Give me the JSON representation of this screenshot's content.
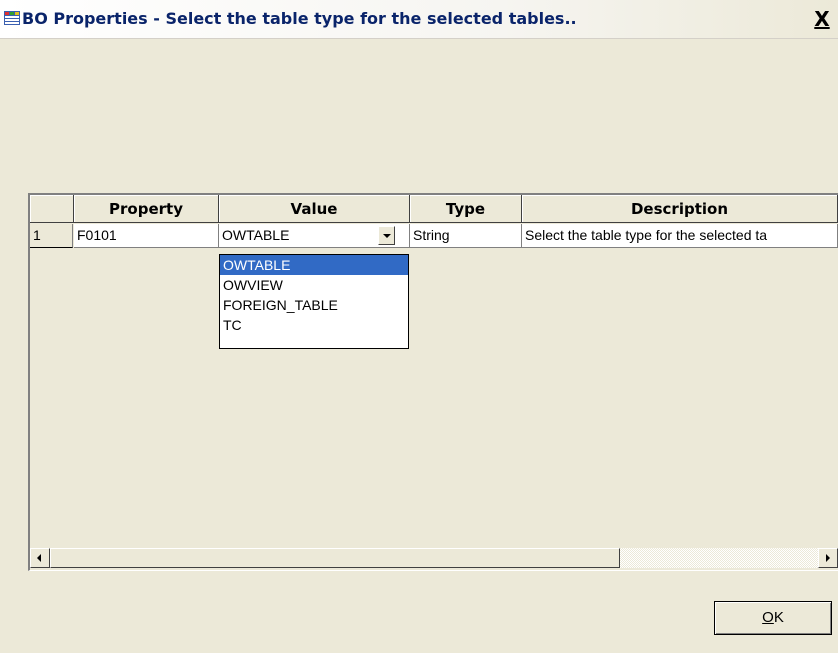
{
  "window": {
    "title": "BO Properties - Select the table type for the selected tables..",
    "close_label": "X"
  },
  "grid": {
    "columns": [
      "",
      "Property",
      "Value",
      "Type",
      "Description"
    ],
    "rows": [
      {
        "num": "1",
        "property": "F0101",
        "value": "OWTABLE",
        "type": "String",
        "description": "Select the table type for the selected ta"
      }
    ]
  },
  "dropdown": {
    "options": [
      "OWTABLE",
      "OWVIEW",
      "FOREIGN_TABLE",
      "TC"
    ],
    "selected": "OWTABLE"
  },
  "buttons": {
    "ok_underlined": "O",
    "ok_rest": "K"
  },
  "colors": {
    "selection": "#316ac5",
    "window_bg": "#ece9d8"
  }
}
